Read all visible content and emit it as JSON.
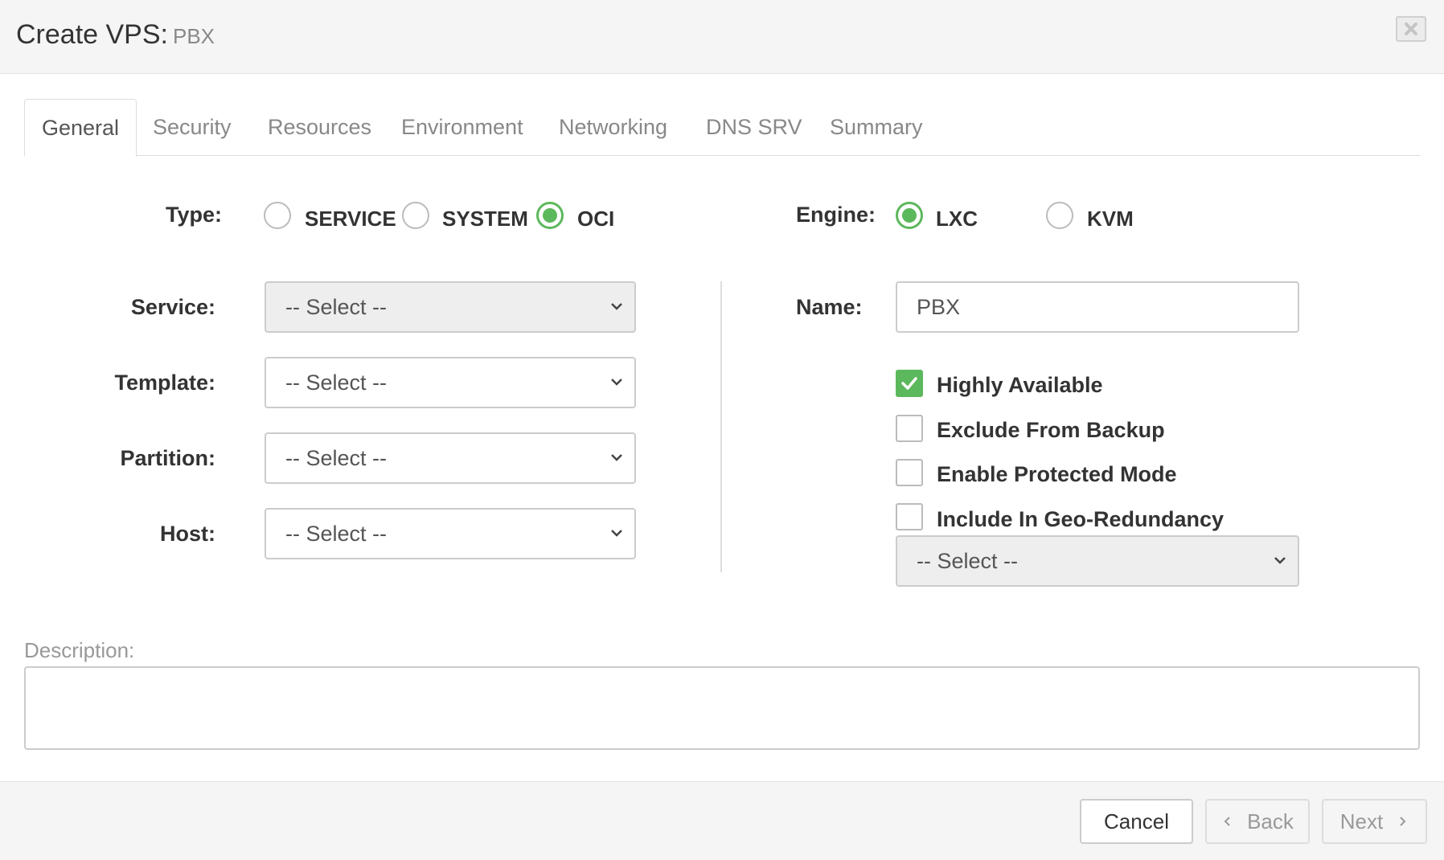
{
  "dialog": {
    "title": "Create VPS:",
    "subtitle": "PBX",
    "close_icon": "close-icon"
  },
  "tabs": [
    {
      "label": "General",
      "active": true
    },
    {
      "label": "Security",
      "active": false
    },
    {
      "label": "Resources",
      "active": false
    },
    {
      "label": "Environment",
      "active": false
    },
    {
      "label": "Networking",
      "active": false
    },
    {
      "label": "DNS SRV",
      "active": false
    },
    {
      "label": "Summary",
      "active": false
    }
  ],
  "type": {
    "label": "Type:",
    "options": [
      "SERVICE",
      "SYSTEM",
      "OCI"
    ],
    "selected": "OCI"
  },
  "engine": {
    "label": "Engine:",
    "options": [
      "LXC",
      "KVM"
    ],
    "selected": "LXC"
  },
  "left_fields": {
    "service": {
      "label": "Service:",
      "value": "-- Select --",
      "disabled": true
    },
    "template": {
      "label": "Template:",
      "value": "-- Select --"
    },
    "partition": {
      "label": "Partition:",
      "value": "-- Select --"
    },
    "host": {
      "label": "Host:",
      "value": "-- Select --"
    }
  },
  "name": {
    "label": "Name:",
    "value": "PBX"
  },
  "checkboxes": [
    {
      "label": "Highly Available",
      "checked": true
    },
    {
      "label": "Exclude From Backup",
      "checked": false
    },
    {
      "label": "Enable Protected Mode",
      "checked": false
    },
    {
      "label": "Include In Geo-Redundancy",
      "checked": false
    }
  ],
  "geo_select": {
    "value": "-- Select --",
    "disabled": true
  },
  "description": {
    "label": "Description:",
    "value": ""
  },
  "footer": {
    "cancel_label": "Cancel",
    "back_label": "Back",
    "next_label": "Next"
  },
  "colors": {
    "accent": "#5cb85c",
    "header_bg": "#f5f5f5"
  }
}
